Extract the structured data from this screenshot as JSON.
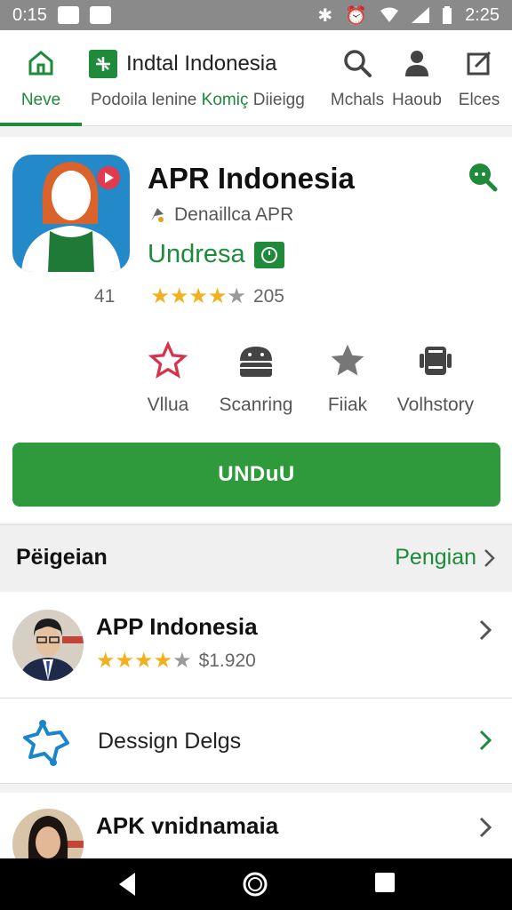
{
  "status_bar": {
    "time": "0:15",
    "clock": "2:25"
  },
  "top_nav": {
    "home_label": "Neve",
    "brand_title": "Indtal Indonesia",
    "brand_sub_prefix": "Podoila lenine ",
    "brand_sub_green": "Komiç",
    "brand_sub_suffix": " Diieigg",
    "search_label": "Mchals",
    "profile_label": "Haoub",
    "edit_label": "Elces"
  },
  "app": {
    "title": "APR Indonesia",
    "developer": "Denaillca APR",
    "category": "Undresa",
    "rating_left": "41",
    "rating_stars": 4,
    "rating_count": "205",
    "download_label": "UNDuU"
  },
  "actions": [
    {
      "label": "Vllua",
      "icon": "star-outline-icon"
    },
    {
      "label": "Scanring",
      "icon": "android-icon"
    },
    {
      "label": "Fiiak",
      "icon": "star-icon"
    },
    {
      "label": "Volhstory",
      "icon": "robot-icon"
    }
  ],
  "section": {
    "title": "Pëigeian",
    "link_label": "Pengian"
  },
  "list": [
    {
      "title": "APP Indonesia",
      "stars": 4,
      "price": "$1.920"
    },
    {
      "title": "Dessign Delgs"
    },
    {
      "title": "APK vnidnamаia"
    }
  ],
  "colors": {
    "green": "#1e8a3a",
    "button_green": "#2e9a3c",
    "star": "#f2b01e",
    "app_icon_blue": "#2389c9"
  }
}
